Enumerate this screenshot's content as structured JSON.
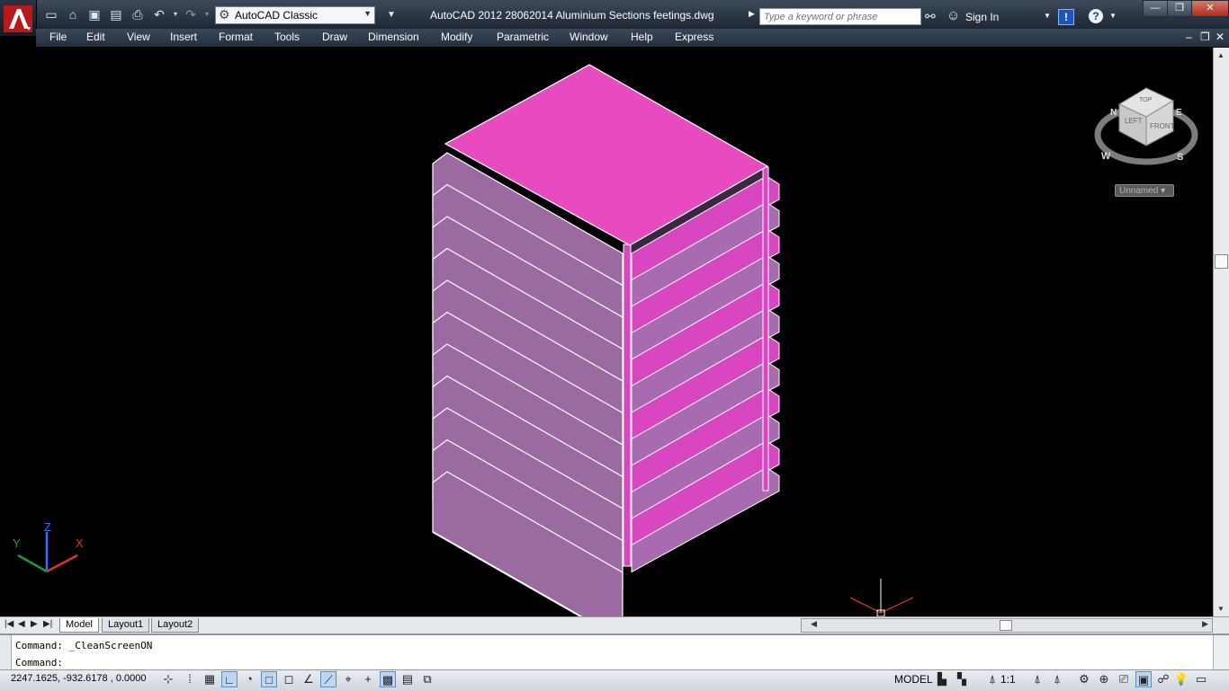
{
  "app": {
    "title": "AutoCAD 2012    28062014 Aluminium Sections feetings.dwg",
    "workspace": "AutoCAD Classic",
    "search_placeholder": "Type a keyword or phrase",
    "sign_in": "Sign In"
  },
  "quick_access": [
    "new-icon",
    "open-icon",
    "save-icon",
    "saveas-icon",
    "plot-icon",
    "undo-icon",
    "redo-icon"
  ],
  "menus": [
    "File",
    "Edit",
    "View",
    "Insert",
    "Format",
    "Tools",
    "Draw",
    "Dimension",
    "Modify",
    "Parametric",
    "Window",
    "Help",
    "Express"
  ],
  "viewcube": {
    "faces": [
      "TOP",
      "LEFT",
      "FRONT"
    ],
    "compass": [
      "N",
      "E",
      "S",
      "W"
    ],
    "ucs_menu": "Unnamed"
  },
  "ucs_labels": {
    "x": "X",
    "y": "Y",
    "z": "Z"
  },
  "tabs": [
    {
      "label": "Model",
      "active": true
    },
    {
      "label": "Layout1",
      "active": false
    },
    {
      "label": "Layout2",
      "active": false
    }
  ],
  "command": {
    "history": "Command:  _CleanScreenON",
    "prompt": "Command:"
  },
  "status": {
    "coordinates": "2247.1625, -932.6178 , 0.0000",
    "space": "MODEL",
    "annotation_scale": "1:1"
  },
  "colors": {
    "top_face": "#e84bbf",
    "front_fins": "#9b6aa0",
    "side_fins": "#d846c0",
    "edge_lines": "#ffffff",
    "background": "#000000"
  }
}
